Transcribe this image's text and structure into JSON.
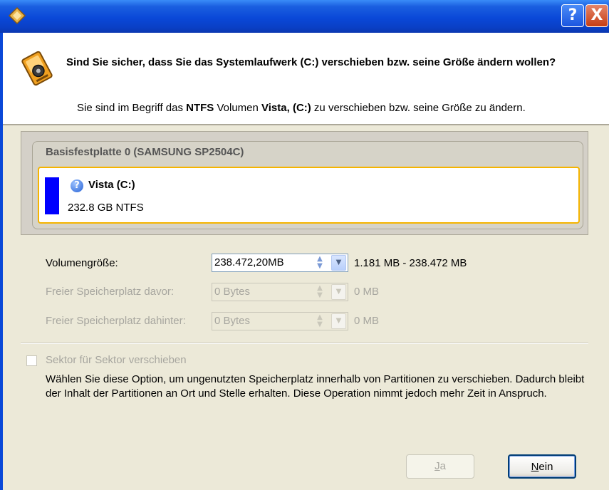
{
  "titlebar": {
    "app_icon": "diamond-app-icon",
    "help_label": "?",
    "close_label": "X"
  },
  "header": {
    "icon": "hard-drive-warning-icon",
    "question": "Sind Sie sicher, dass Sie das Systemlaufwerk (C:) verschieben bzw. seine Größe ändern wollen?",
    "sub_prefix": "Sie sind im Begriff das ",
    "sub_fs": "NTFS",
    "sub_middle": " Volumen ",
    "sub_volume": "Vista, (C:)",
    "sub_suffix": " zu verschieben bzw. seine Größe zu ändern."
  },
  "disk": {
    "label": "Basisfestplatte 0 (SAMSUNG SP2504C)",
    "partition": {
      "name": "Vista (C:)",
      "info": "232.8 GB NTFS",
      "bar_color": "#0000ff",
      "selected_border": "#f5b400"
    }
  },
  "form": {
    "volume_size": {
      "label": "Volumengröße:",
      "value": "238.472,20MB",
      "range": "1.181 MB - 238.472 MB"
    },
    "free_before": {
      "label": "Freier Speicherplatz davor:",
      "value": "0 Bytes",
      "range": "0 MB"
    },
    "free_after": {
      "label": "Freier Speicherplatz dahinter:",
      "value": "0 Bytes",
      "range": "0 MB"
    }
  },
  "sector": {
    "checkbox_label": "Sektor für Sektor verschieben",
    "checked": false,
    "description": "Wählen Sie diese Option, um ungenutzten Speicherplatz innerhalb von Partitionen zu verschieben. Dadurch bleibt der Inhalt der Partitionen an Ort und Stelle erhalten. Diese Operation nimmt jedoch mehr Zeit in Anspruch."
  },
  "buttons": {
    "yes_mnemonic": "J",
    "yes_rest": "a",
    "no_mnemonic": "N",
    "no_rest": "ein"
  }
}
